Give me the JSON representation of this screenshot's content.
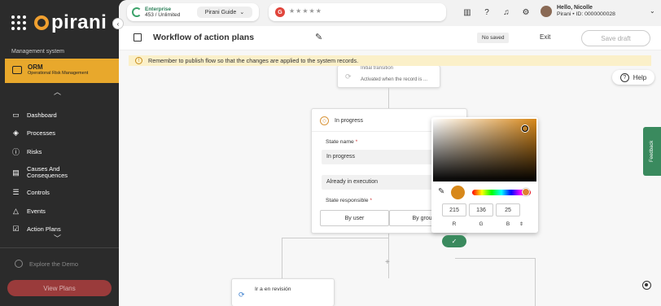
{
  "sidebar": {
    "logo_text": "pirani",
    "system_label": "Management system",
    "module": {
      "title": "ORM",
      "subtitle": "Operational Risk Management"
    },
    "items": [
      {
        "label": "Dashboard",
        "icon": "monitor-icon"
      },
      {
        "label": "Processes",
        "icon": "layers-icon"
      },
      {
        "label": "Risks",
        "icon": "alert-circle-icon"
      },
      {
        "label": "Causes And Consequences",
        "icon": "document-icon"
      },
      {
        "label": "Controls",
        "icon": "sliders-icon"
      },
      {
        "label": "Events",
        "icon": "warning-triangle-icon"
      },
      {
        "label": "Action Plans",
        "icon": "checkbox-icon"
      }
    ],
    "demo_label": "Explore the Demo",
    "view_plans_label": "View Plans"
  },
  "topbar": {
    "plan_name": "Enterprise",
    "plan_usage": "453 / Unlimited",
    "guide_label": "Pirani Guide",
    "stars": "★★★★★",
    "user_name": "Hello, Nicolle",
    "user_id": "Pirani • ID: 0000000028"
  },
  "header": {
    "title": "Workflow of action plans",
    "status_badge": "No saved",
    "exit_label": "Exit",
    "save_label": "Save draft"
  },
  "alert": {
    "message": "Remember to publish flow so that the changes are applied to the system records."
  },
  "help_label": "Help",
  "feedback_label": "Feedback",
  "initial_node": {
    "title": "Initial transition",
    "description": "Activated when the record is ..."
  },
  "state_node": {
    "title": "In progress",
    "state_name_label": "State name",
    "state_name_value": "In progress",
    "description_value": "Already in execution",
    "responsible_label": "State responsible",
    "by_user_label": "By user",
    "by_group_label": "By group"
  },
  "color_picker": {
    "color": "#d7881a",
    "r": "215",
    "g": "136",
    "b": "25",
    "r_label": "R",
    "g_label": "G",
    "b_label": "B"
  },
  "bottom_node": {
    "title": "Ir a en revisión"
  },
  "colors": {
    "accent": "#e8a82c",
    "success": "#3a8a5e",
    "danger": "#9a3b3b"
  }
}
